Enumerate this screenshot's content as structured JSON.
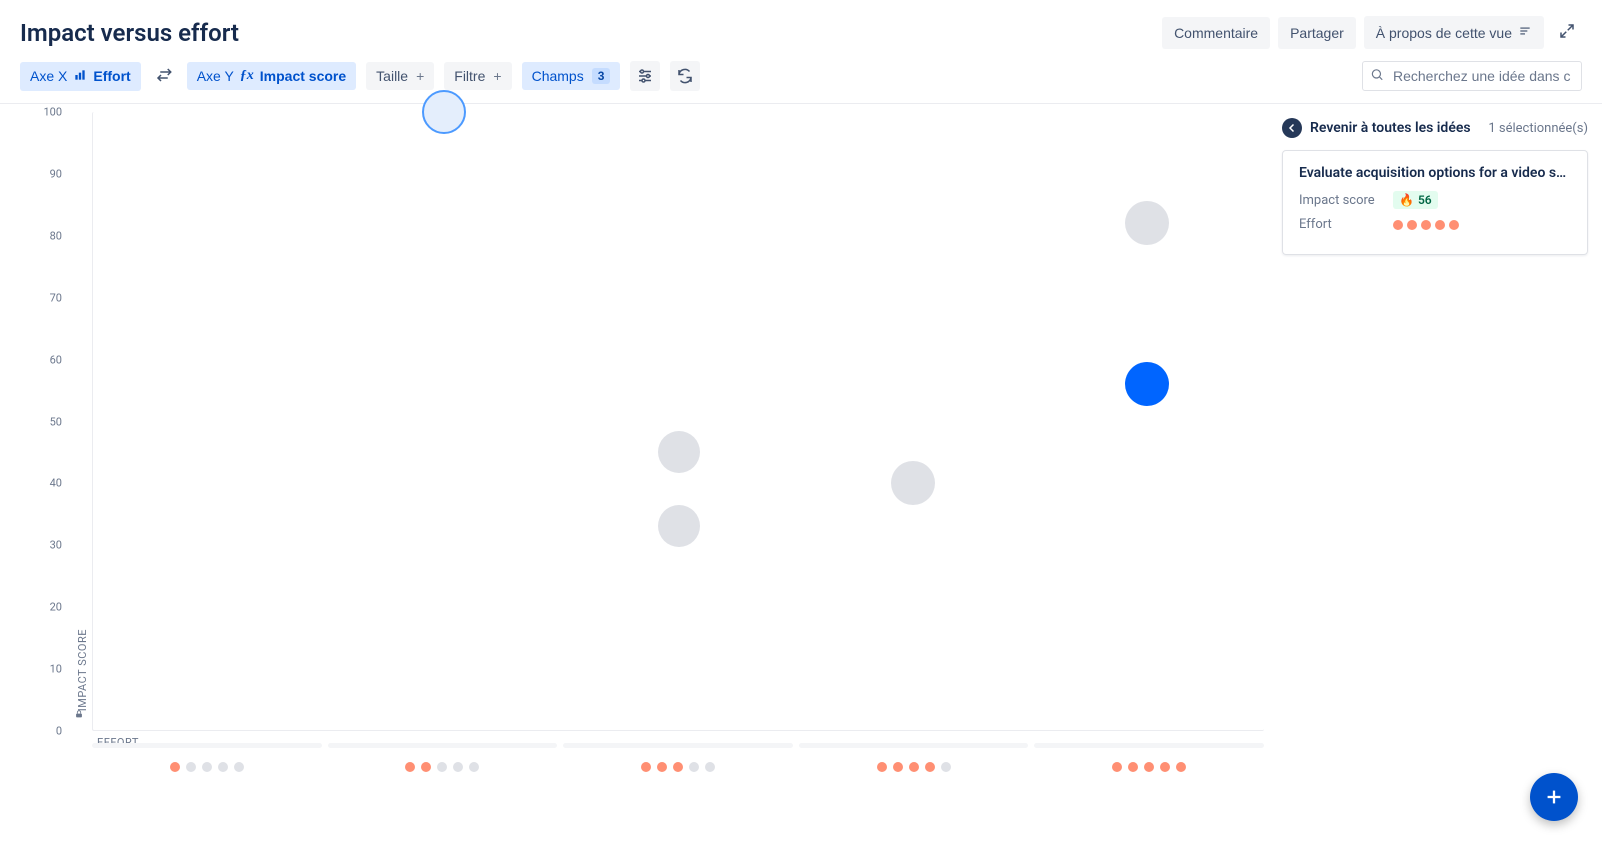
{
  "header": {
    "title": "Impact versus effort",
    "comment_btn": "Commentaire",
    "share_btn": "Partager",
    "about_btn": "À propos de cette vue"
  },
  "toolbar": {
    "axis_x_label": "Axe X",
    "axis_x_value": "Effort",
    "axis_y_label": "Axe Y",
    "axis_y_value": "Impact score",
    "size_label": "Taille",
    "filter_label": "Filtre",
    "fields_label": "Champs",
    "fields_count": "3",
    "search_placeholder": "Recherchez une idée dans cette vue"
  },
  "side": {
    "back_label": "Revenir à toutes les idées",
    "selected_text": "1 sélectionnée(s)",
    "card": {
      "title": "Evaluate acquisition options for a video s…",
      "impact_label": "Impact score",
      "impact_value": "56",
      "impact_emoji": "🔥",
      "effort_label": "Effort",
      "effort_dots_on": 5,
      "effort_dots_total": 5
    }
  },
  "chart_data": {
    "type": "scatter",
    "title": "Impact versus effort",
    "xlabel": "EFFORT",
    "ylabel": "IMPACT SCORE",
    "x_categories": [
      1,
      2,
      3,
      4,
      5
    ],
    "x_category_slots": 5,
    "y_ticks": [
      0,
      10,
      20,
      30,
      40,
      50,
      60,
      70,
      80,
      90,
      100
    ],
    "ylim": [
      0,
      100
    ],
    "points": [
      {
        "effort": 2,
        "impact": 100,
        "size": 22,
        "state": "outline"
      },
      {
        "effort": 3,
        "impact": 45,
        "size": 21,
        "state": "gray"
      },
      {
        "effort": 3,
        "impact": 33,
        "size": 21,
        "state": "gray"
      },
      {
        "effort": 4,
        "impact": 40,
        "size": 22,
        "state": "gray"
      },
      {
        "effort": 5,
        "impact": 56,
        "size": 22,
        "state": "selected"
      },
      {
        "effort": 5,
        "impact": 82,
        "size": 22,
        "state": "gray"
      }
    ]
  }
}
